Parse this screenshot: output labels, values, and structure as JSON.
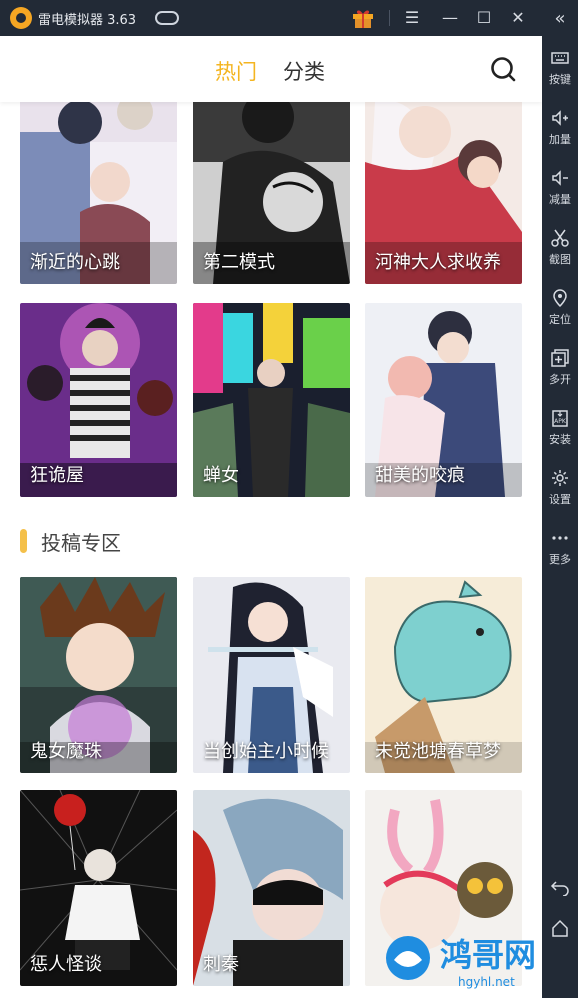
{
  "window": {
    "title": "雷电模拟器 3.63",
    "icons": [
      "app-logo",
      "gamepad-icon",
      "gift-icon",
      "menu-icon",
      "minimize-icon",
      "maximize-icon",
      "close-icon"
    ],
    "accent": "#f5a623"
  },
  "sidebar": {
    "items": [
      {
        "label": "按键",
        "icon": "keyboard-icon"
      },
      {
        "label": "加量",
        "icon": "volume-up-icon"
      },
      {
        "label": "减量",
        "icon": "volume-down-icon"
      },
      {
        "label": "截图",
        "icon": "scissors-icon"
      },
      {
        "label": "定位",
        "icon": "location-icon"
      },
      {
        "label": "多开",
        "icon": "multi-open-icon"
      },
      {
        "label": "安装",
        "icon": "apk-install-icon"
      },
      {
        "label": "设置",
        "icon": "gear-icon"
      },
      {
        "label": "更多",
        "icon": "more-icon"
      }
    ],
    "nav": [
      "back-icon",
      "home-icon"
    ]
  },
  "app": {
    "tabs": [
      {
        "label": "热门",
        "active": true
      },
      {
        "label": "分类",
        "active": false
      }
    ],
    "accent": "#f4b521",
    "hot_comics": [
      {
        "title": "渐近的心跳"
      },
      {
        "title": "第二模式"
      },
      {
        "title": "河神大人求收养"
      },
      {
        "title": "狂诡屋"
      },
      {
        "title": "蝉女"
      },
      {
        "title": "甜美的咬痕"
      }
    ],
    "submission_section": {
      "title": "投稿专区",
      "comics": [
        {
          "title": "鬼女魔珠"
        },
        {
          "title": "当创始主小时候"
        },
        {
          "title": "未觉池塘春草梦"
        },
        {
          "title": "惩人怪谈"
        },
        {
          "title": "刺秦"
        },
        {
          "title": ""
        }
      ]
    }
  },
  "watermark": {
    "text": "鸿哥网",
    "sub": "hgyhl.net"
  }
}
